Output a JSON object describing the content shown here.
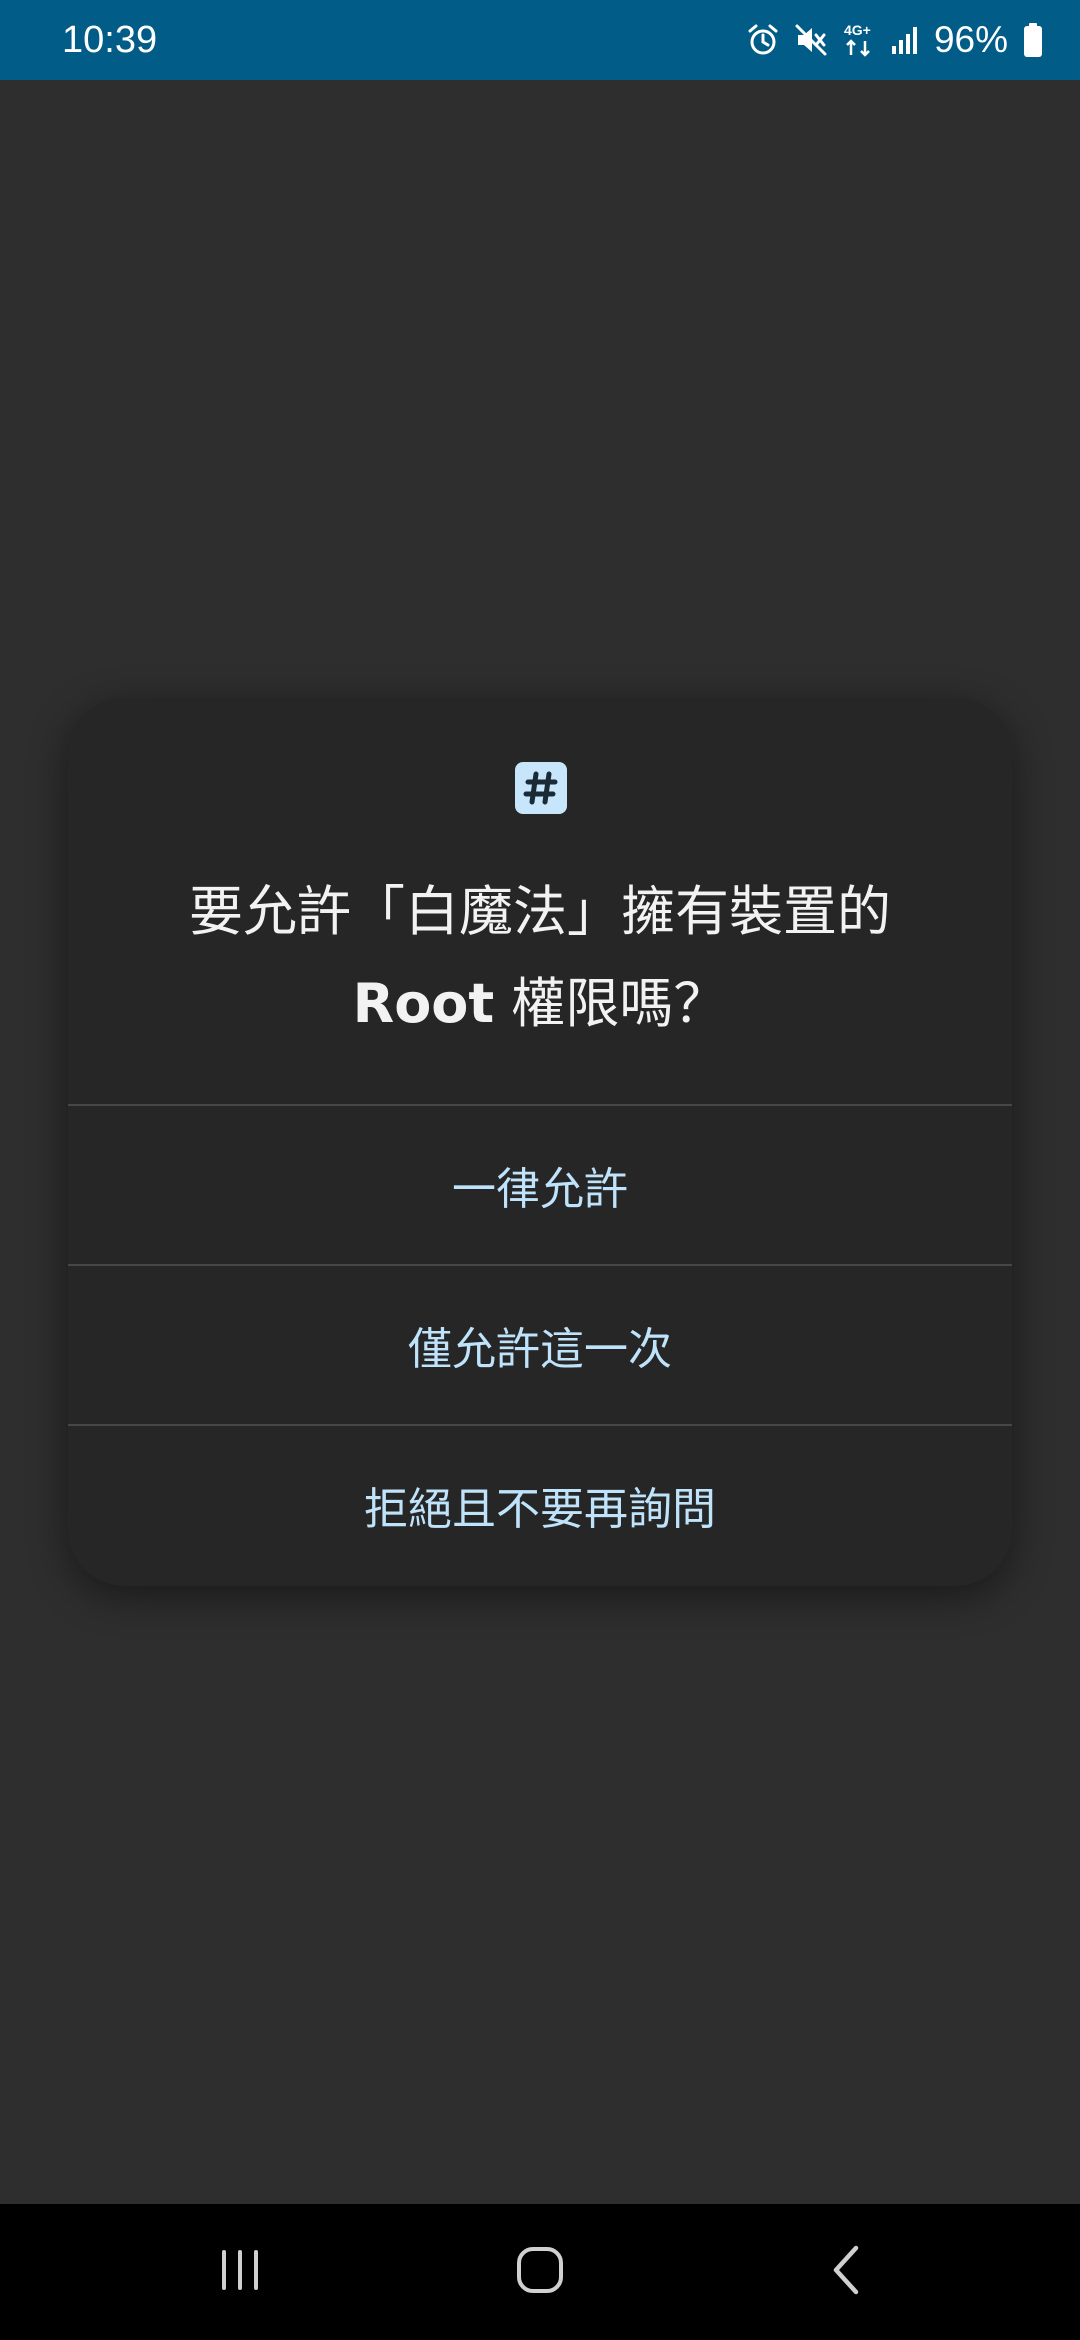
{
  "status_bar": {
    "time": "10:39",
    "battery": "96%",
    "icons": [
      "alarm-icon",
      "mute-icon",
      "4g-plus-icon",
      "signal-icon",
      "battery-icon"
    ],
    "network_label": "4G+",
    "background_color": "#015c87"
  },
  "dialog": {
    "icon": "hash-icon",
    "title_line1": "要允許「白魔法」擁有裝置的",
    "title_root": "Root",
    "title_line2_rest": " 權限嗎？",
    "buttons": [
      {
        "label": "一律允許"
      },
      {
        "label": "僅允許這一次"
      },
      {
        "label": "拒絕且不要再詢問"
      }
    ],
    "accent_color": "#bfe3fa",
    "background_color": "#262626"
  },
  "nav_bar": {
    "icons": [
      "recent-apps-icon",
      "home-icon",
      "back-icon"
    ]
  }
}
